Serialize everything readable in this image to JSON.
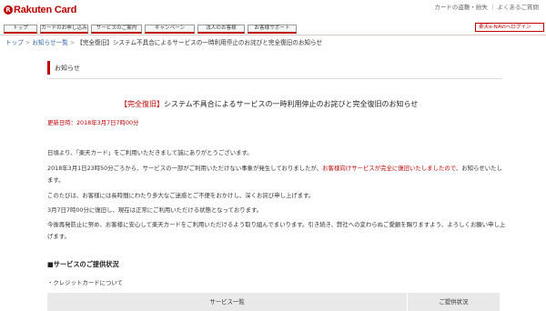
{
  "header": {
    "logo_mark": "R",
    "logo_text": "Rakuten Card",
    "util_links": "カードの盗難・紛失 ｜ よくあるご質問"
  },
  "gnav": {
    "items": [
      {
        "label": "トップ"
      },
      {
        "label": "カードのお申し込み"
      },
      {
        "label": "サービスのご案内"
      },
      {
        "label": "キャンペーン"
      },
      {
        "label": "法人のお客様"
      },
      {
        "label": "お客様サポート"
      }
    ],
    "right_link": "楽天e-NAVIへログイン"
  },
  "breadcrumb": {
    "home": "トップ",
    "news": "お知らせ一覧",
    "current": "【完全復旧】システム不具合によるサービスの一時利用停止のお詫びと完全復旧のお知らせ",
    "sep": ">"
  },
  "section": {
    "title": "お知らせ"
  },
  "article": {
    "tag": "【完全復旧】",
    "title": "システム不具合によるサービスの一時利用停止のお詫びと完全復旧のお知らせ",
    "updated": "更新日時：2018年3月7日7時00分",
    "p1": "日頃より、「楽天カード」をご利用いただきまして誠にありがとうございます。",
    "p2a": "2018年3月1日23時50分ごろから、サービスの一部がご利用いただけない事象が発生しておりましたが、",
    "p2b": "お客様向けサービスが完全に復旧いたしましたので",
    "p2c": "、お知らせいたします。",
    "p3": "このたびは、お客様には長時間にわたり多大なご迷惑とご不便をおかけし、深くお詫び申し上げます。",
    "p4": "3月7日7時00分に復旧し、現在は正常にご利用いただける状態となっております。",
    "p5": "今後再発防止に努め、お客様に安心して楽天カードをご利用いただけるよう取り組んでまいります。引き続き、弊社への変わらぬご愛顧を賜りますよう、よろしくお願い申し上げます。",
    "subhead": "■サービスのご提供状況",
    "bullet": "・クレジットカードについて",
    "table_headers": [
      "サービス一覧",
      "ご提供状況"
    ]
  }
}
